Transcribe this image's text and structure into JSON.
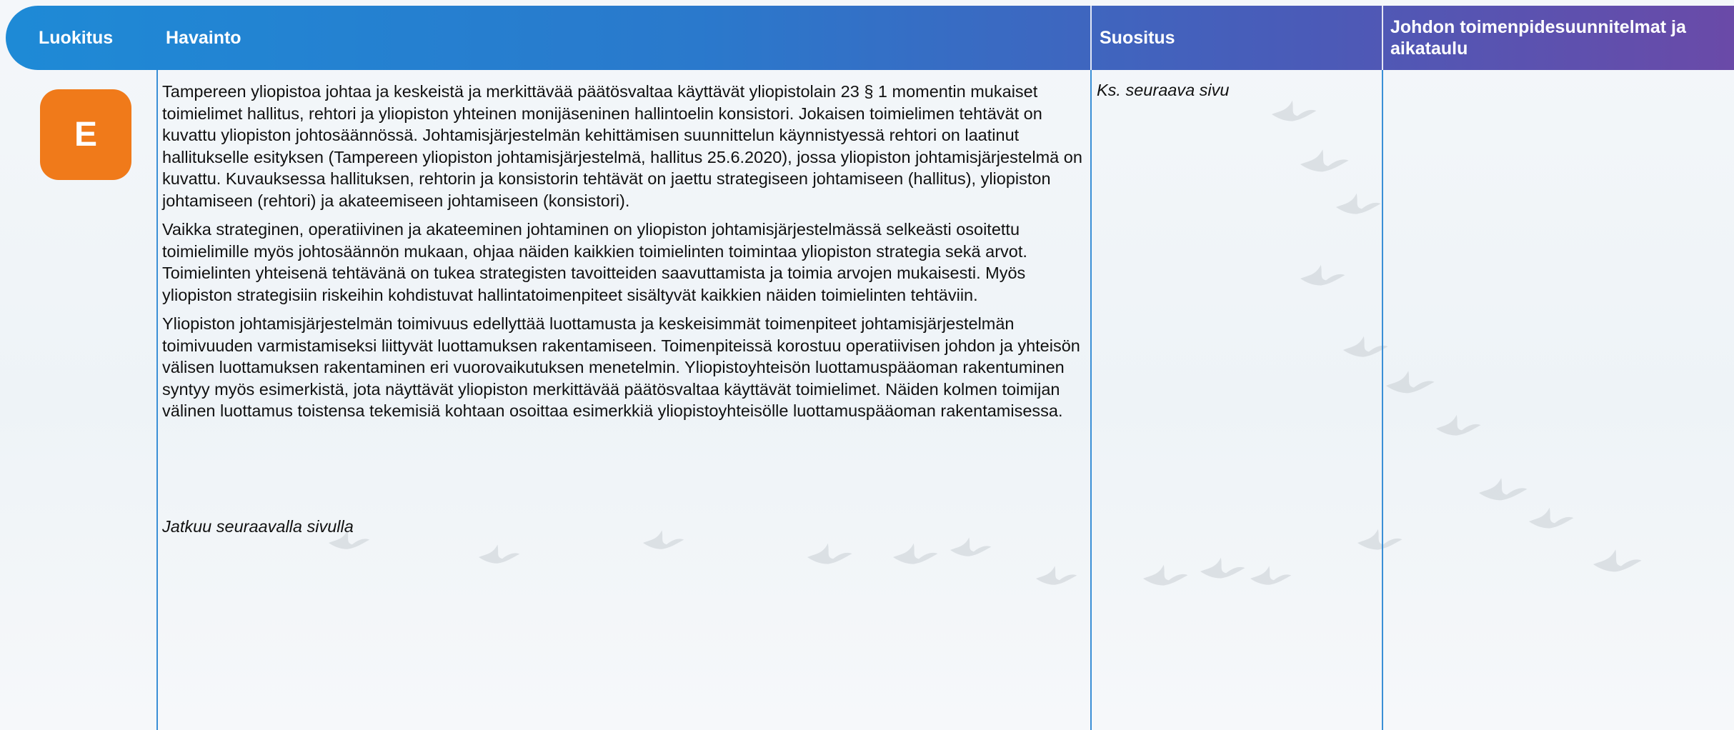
{
  "header": {
    "col_classification": "Luokitus",
    "col_finding": "Havainto",
    "col_recommendation": "Suositus",
    "col_management_plan": "Johdon toimenpidesuunnitelmat ja aikataulu"
  },
  "row": {
    "classification": "E",
    "classification_color": "#f07a1a",
    "finding_paragraphs": [
      "Tampereen yliopistoa johtaa ja keskeistä ja merkittävää päätösvaltaa käyttävät yliopistolain 23 § 1 momentin mukaiset toimielimet hallitus, rehtori ja yliopiston yhteinen monijäseninen hallintoelin konsistori. Jokaisen toimielimen tehtävät on kuvattu yliopiston johtosäännössä. Johtamisjärjestelmän kehittämisen suunnittelun käynnistyessä rehtori on laatinut hallitukselle esityksen (Tampereen yliopiston johtamisjärjestelmä, hallitus 25.6.2020), jossa yliopiston johtamisjärjestelmä on kuvattu. Kuvauksessa hallituksen, rehtorin ja konsistorin tehtävät on jaettu strategiseen johtamiseen (hallitus), yliopiston johtamiseen (rehtori) ja akateemiseen johtamiseen (konsistori).",
      "Vaikka strateginen, operatiivinen ja akateeminen johtaminen on yliopiston johtamisjärjestelmässä selkeästi osoitettu toimielimille myös johtosäännön mukaan, ohjaa näiden kaikkien toimielinten toimintaa yliopiston strategia sekä arvot. Toimielinten yhteisenä tehtävänä on tukea strategisten tavoitteiden saavuttamista ja toimia arvojen mukaisesti. Myös yliopiston strategisiin riskeihin kohdistuvat hallintatoimenpiteet sisältyvät kaikkien näiden toimielinten tehtäviin.",
      "Yliopiston johtamisjärjestelmän toimivuus edellyttää luottamusta ja keskeisimmät toimenpiteet johtamisjärjestelmän toimivuuden varmistamiseksi liittyvät luottamuksen rakentamiseen. Toimenpiteissä korostuu operatiivisen johdon ja yhteisön välisen luottamuksen rakentaminen eri vuorovaikutuksen menetelmin. Yliopistoyhteisön luottamuspääoman rakentuminen syntyy myös esimerkistä, jota näyttävät yliopiston merkittävää päätösvaltaa käyttävät toimielimet. Näiden kolmen toimijan välinen luottamus toistensa tekemisiä kohtaan osoittaa esimerkkiä yliopistoyhteisölle luottamuspääoman rakentamisessa."
    ],
    "continues_note": "Jatkuu seuraavalla sivulla",
    "recommendation": "Ks. seuraava sivu",
    "management_plan": ""
  }
}
